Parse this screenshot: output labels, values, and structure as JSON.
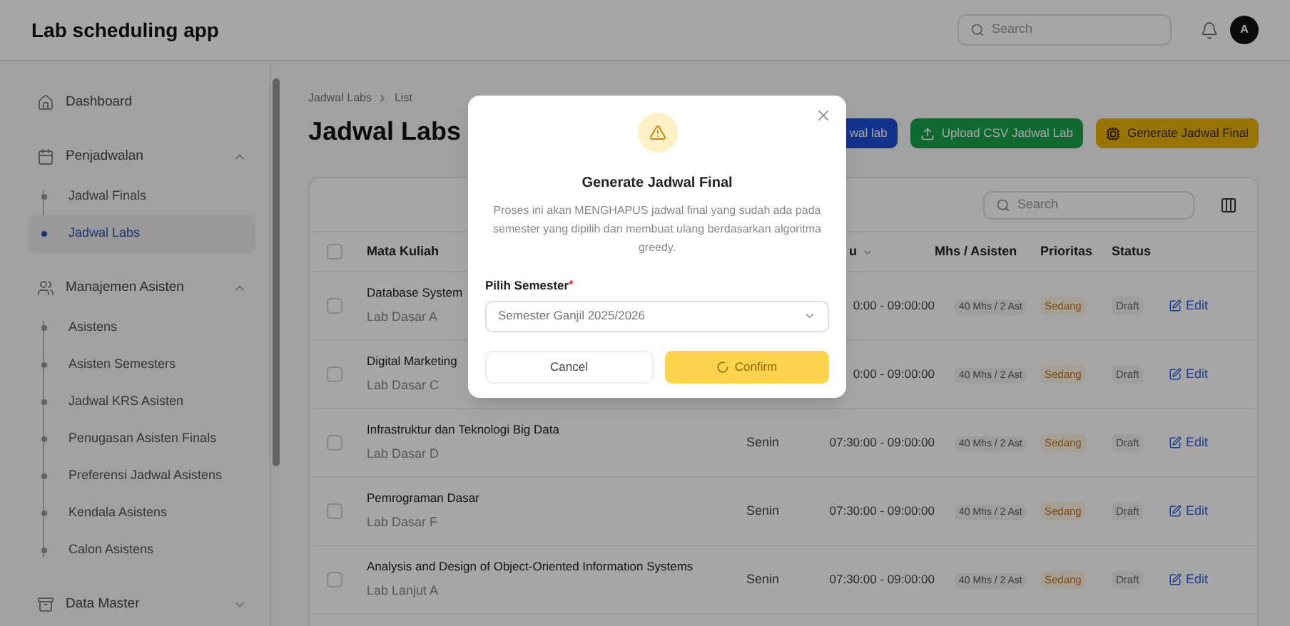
{
  "app": {
    "title": "Lab scheduling app"
  },
  "topbar": {
    "search": {
      "placeholder": "Search"
    },
    "avatar": "A"
  },
  "sidebar": {
    "items": [
      {
        "label": "Dashboard"
      },
      {
        "label": "Penjadwalan",
        "expanded": true,
        "children": [
          {
            "label": "Jadwal Finals",
            "selected": false
          },
          {
            "label": "Jadwal Labs",
            "selected": true
          }
        ]
      },
      {
        "label": "Manajemen Asisten",
        "expanded": true,
        "children": [
          {
            "label": "Asistens",
            "selected": false
          },
          {
            "label": "Asisten Semesters",
            "selected": false
          },
          {
            "label": "Jadwal KRS Asisten",
            "selected": false
          },
          {
            "label": "Penugasan Asisten Finals",
            "selected": false
          },
          {
            "label": "Preferensi Jadwal Asistens",
            "selected": false
          },
          {
            "label": "Kendala Asistens",
            "selected": false
          },
          {
            "label": "Calon Asistens",
            "selected": false
          }
        ]
      },
      {
        "label": "Data Master",
        "expanded": false
      }
    ]
  },
  "breadcrumb": [
    "Jadwal Labs",
    "List"
  ],
  "page_title": "Jadwal Labs",
  "actions": [
    {
      "label": "wal lab",
      "kind": "primary"
    },
    {
      "label": "Upload CSV Jadwal Lab",
      "kind": "upload"
    },
    {
      "label": "Generate Jadwal Final",
      "kind": "generate"
    }
  ],
  "table": {
    "search": {
      "placeholder": "Search"
    },
    "all_checked": false,
    "columns": [
      {
        "label": "Mata Kuliah",
        "sortable": false
      },
      {
        "label": "u",
        "sortable": true
      },
      {
        "label": "Mhs / Asisten",
        "sortable": false
      },
      {
        "label": "Prioritas",
        "sortable": false
      },
      {
        "label": "Status",
        "sortable": false
      }
    ],
    "rows": [
      {
        "course": "Database System",
        "lab": "Lab Dasar A",
        "time": "0:00 - 09:00:00",
        "students": "40 Mhs / 2 Ast",
        "priority": "Sedang",
        "status": "Draft",
        "action": "Edit",
        "checked": false
      },
      {
        "course": "Digital Marketing",
        "lab": "Lab Dasar C",
        "time": "0:00 - 09:00:00",
        "students": "40 Mhs / 2 Ast",
        "priority": "Sedang",
        "status": "Draft",
        "action": "Edit",
        "checked": false
      },
      {
        "course": "Infrastruktur dan Teknologi Big Data",
        "lab": "Lab Dasar D",
        "day": "Senin",
        "time": "07:30:00 - 09:00:00",
        "students": "40 Mhs / 2 Ast",
        "priority": "Sedang",
        "status": "Draft",
        "action": "Edit",
        "checked": false
      },
      {
        "course": "Pemrograman Dasar",
        "lab": "Lab Dasar F",
        "day": "Senin",
        "time": "07:30:00 - 09:00:00",
        "students": "40 Mhs / 2 Ast",
        "priority": "Sedang",
        "status": "Draft",
        "action": "Edit",
        "checked": false
      },
      {
        "course": "Analysis and Design of Object-Oriented Information Systems",
        "lab": "Lab Lanjut A",
        "day": "Senin",
        "time": "07:30:00 - 09:00:00",
        "students": "40 Mhs / 2 Ast",
        "priority": "Sedang",
        "status": "Draft",
        "action": "Edit",
        "checked": false
      }
    ]
  },
  "modal": {
    "title": "Generate Jadwal Final",
    "message": "Proses ini akan MENGHAPUS jadwal final yang sudah ada pada semester yang dipilih dan membuat ulang berdasarkan algoritma greedy.",
    "field": {
      "label": "Pilih Semester",
      "required_mark": "*",
      "value": "Semester Ganjil 2025/2026"
    },
    "buttons": [
      {
        "label": "Cancel",
        "kind": "secondary",
        "loading": false
      },
      {
        "label": "Confirm",
        "kind": "primary",
        "loading": true
      }
    ]
  }
}
